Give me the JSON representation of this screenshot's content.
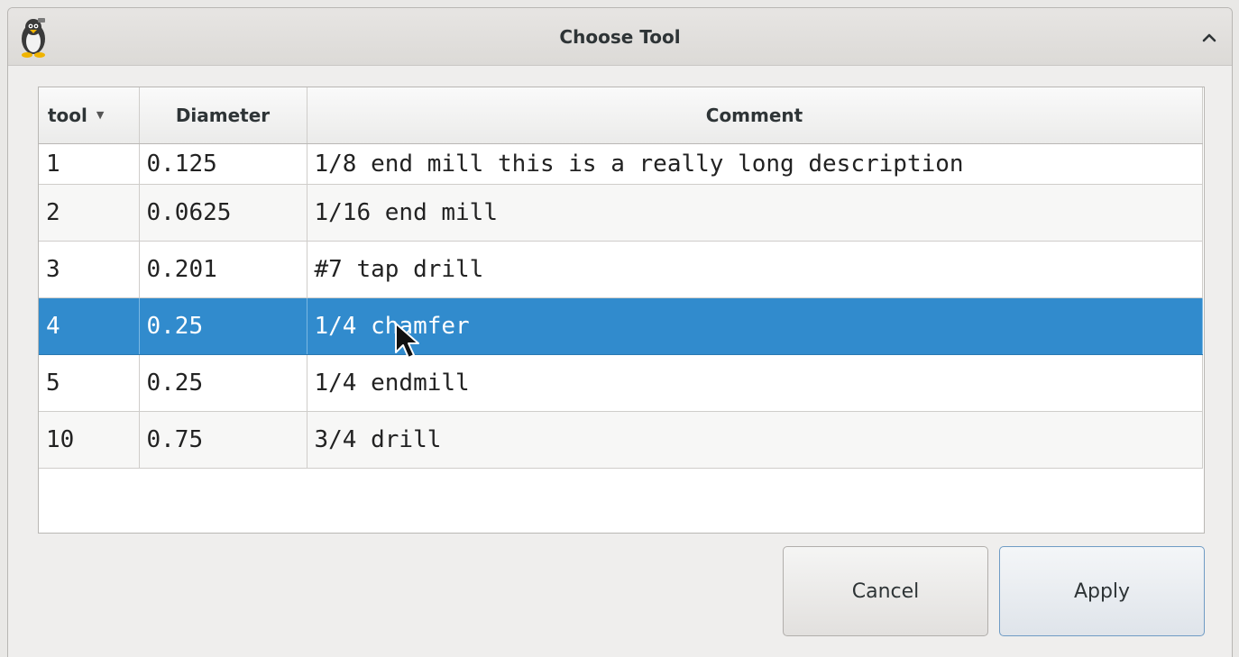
{
  "window": {
    "title": "Choose Tool"
  },
  "table": {
    "columns": [
      {
        "label": "tool",
        "sorted": "descending"
      },
      {
        "label": "Diameter"
      },
      {
        "label": "Comment"
      }
    ],
    "rows": [
      {
        "tool": "1",
        "diameter": "0.125",
        "comment": "1/8 end mill this is a really long description",
        "selected": false
      },
      {
        "tool": "2",
        "diameter": "0.0625",
        "comment": "1/16 end mill",
        "selected": false
      },
      {
        "tool": "3",
        "diameter": "0.201",
        "comment": "#7 tap drill",
        "selected": false
      },
      {
        "tool": "4",
        "diameter": "0.25",
        "comment": "1/4 chamfer",
        "selected": true
      },
      {
        "tool": "5",
        "diameter": "0.25",
        "comment": "1/4 endmill",
        "selected": false
      },
      {
        "tool": "10",
        "diameter": "0.75",
        "comment": "3/4 drill",
        "selected": false
      }
    ]
  },
  "buttons": {
    "cancel_label": "Cancel",
    "apply_label": "Apply"
  },
  "icons": {
    "app": "penguin-app-icon",
    "collapse": "chevron-up-icon",
    "sort": "sort-down-arrow-icon",
    "pointer": "mouse-pointer-icon"
  },
  "colors": {
    "selection": "#318bcd",
    "selection_text": "#ffffff",
    "window_bg": "#efeeed"
  }
}
